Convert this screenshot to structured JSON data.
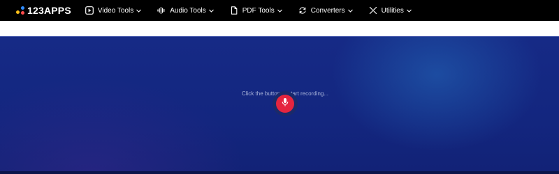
{
  "brand": {
    "name": "123APPS",
    "dot_colors": [
      "#2f8cff",
      "#ffc21a",
      "#ff4d4d"
    ]
  },
  "nav": {
    "items": [
      {
        "label": "Video Tools",
        "icon": "play-icon"
      },
      {
        "label": "Audio Tools",
        "icon": "audio-wave-icon"
      },
      {
        "label": "PDF Tools",
        "icon": "document-icon"
      },
      {
        "label": "Converters",
        "icon": "convert-icon"
      },
      {
        "label": "Utilities",
        "icon": "tools-icon"
      }
    ],
    "chevron_icon": "chevron-down-icon"
  },
  "recorder": {
    "hint": "Click the button to start recording...",
    "record_button_icon": "microphone-icon",
    "accent_color": "#e5253f",
    "background_color": "#142883"
  }
}
